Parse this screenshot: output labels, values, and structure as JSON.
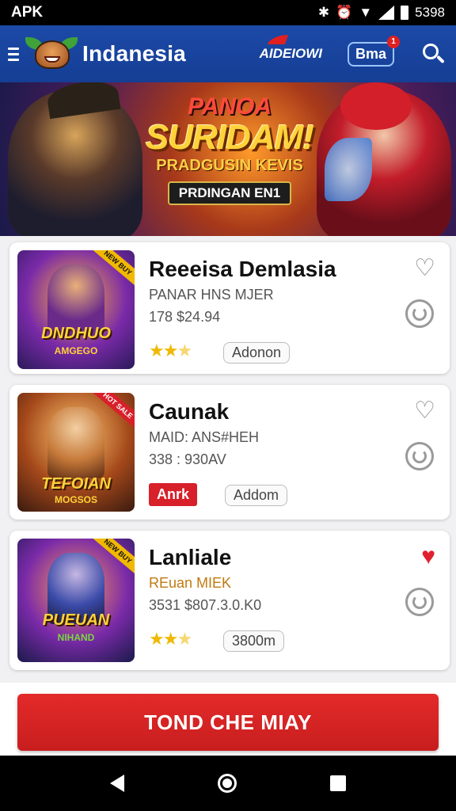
{
  "status_bar": {
    "left_label": "APK",
    "time": "5398",
    "icons": [
      "bluetooth-icon",
      "alarm-icon",
      "wifi-icon",
      "signal-icon",
      "battery-icon"
    ]
  },
  "app_bar": {
    "title": "Indanesia",
    "brand_text": "AIDEIOWI",
    "pill_text": "Bma",
    "notification_count": "1",
    "icons": [
      "menu-icon",
      "logo-icon",
      "search-icon"
    ]
  },
  "banner": {
    "line1": "PANOA",
    "line2": "SURIDAM!",
    "line3": "PRADGUSIN KEVIS",
    "cta": "PRDINGAN EN1",
    "page_count": 3
  },
  "games": [
    {
      "title": "Reeeisa Demlasia",
      "subtitle": "PANAR HNS MJER",
      "price": "178 $24.94",
      "thumb_title": "DNDHUO",
      "thumb_sub": "AMGEGO",
      "thumb_tag": "NEW BUY",
      "rating_stars": 2.5,
      "add_label": "Adonon",
      "favorite": false,
      "accent": "#f0b800"
    },
    {
      "title": "Caunak",
      "subtitle": "MAID: ANS#HEH",
      "price": "338 : 930AV",
      "thumb_title": "TEFOIAN",
      "thumb_sub": "MOGSOS",
      "thumb_tag": "HOT SALE",
      "badge": "Anrk",
      "add_label": "Addom",
      "favorite": false,
      "accent": "#d8202a"
    },
    {
      "title": "Lanliale",
      "subtitle": "REuan MIEK",
      "price": "3531 $807.3.0.K0",
      "thumb_title": "PUEUAN",
      "thumb_sub": "NIHAND",
      "thumb_tag": "NEW BUY",
      "rating_stars": 2.5,
      "add_label": "3800m",
      "favorite": true,
      "accent": "#f0b800"
    }
  ],
  "bottom_cta": "TOND CHE MIAY",
  "nav": [
    "back-icon",
    "home-icon",
    "recents-icon"
  ]
}
